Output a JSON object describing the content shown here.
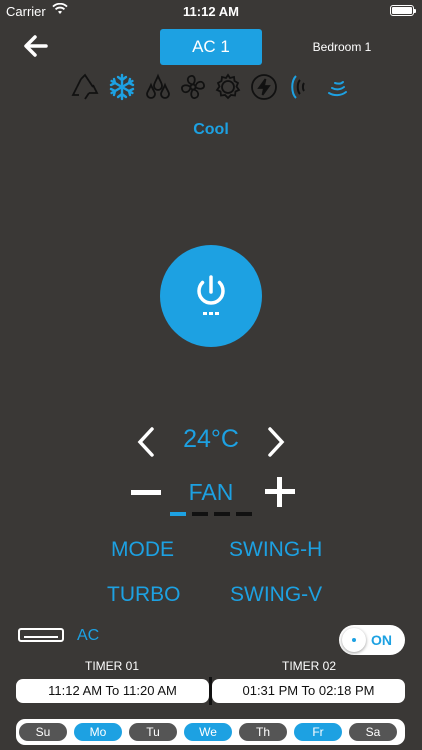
{
  "status_bar": {
    "carrier": "Carrier",
    "time": "11:12 AM"
  },
  "header": {
    "device_tab": "AC 1",
    "room": "Bedroom 1"
  },
  "modes": {
    "icons": [
      "recycle-icon",
      "snowflake-icon",
      "drops-icon",
      "fan-icon",
      "gear-icon",
      "bolt-icon",
      "swing-wave-icon",
      "wind-wave-icon"
    ],
    "selected": "snowflake-icon",
    "selected_label": "Cool"
  },
  "temperature": {
    "value": "24°C"
  },
  "fan": {
    "label": "FAN",
    "level": 1,
    "levels": 4
  },
  "functions": {
    "mode": "MODE",
    "swing_h": "SWING-H",
    "turbo": "TURBO",
    "swing_v": "SWING-V"
  },
  "device": {
    "label": "AC",
    "toggle_label": "ON",
    "on": true
  },
  "timers": {
    "timer1_title": "TIMER 01",
    "timer1_value": "11:12 AM To 11:20 AM",
    "timer2_title": "TIMER 02",
    "timer2_value": "01:31 PM To 02:18 PM"
  },
  "days": [
    {
      "label": "Su",
      "active": false
    },
    {
      "label": "Mo",
      "active": true
    },
    {
      "label": "Tu",
      "active": false
    },
    {
      "label": "We",
      "active": true
    },
    {
      "label": "Th",
      "active": false
    },
    {
      "label": "Fr",
      "active": true
    },
    {
      "label": "Sa",
      "active": false
    }
  ],
  "colors": {
    "accent": "#1da1e2",
    "background": "#3a3836",
    "inactive_day": "#555555"
  }
}
